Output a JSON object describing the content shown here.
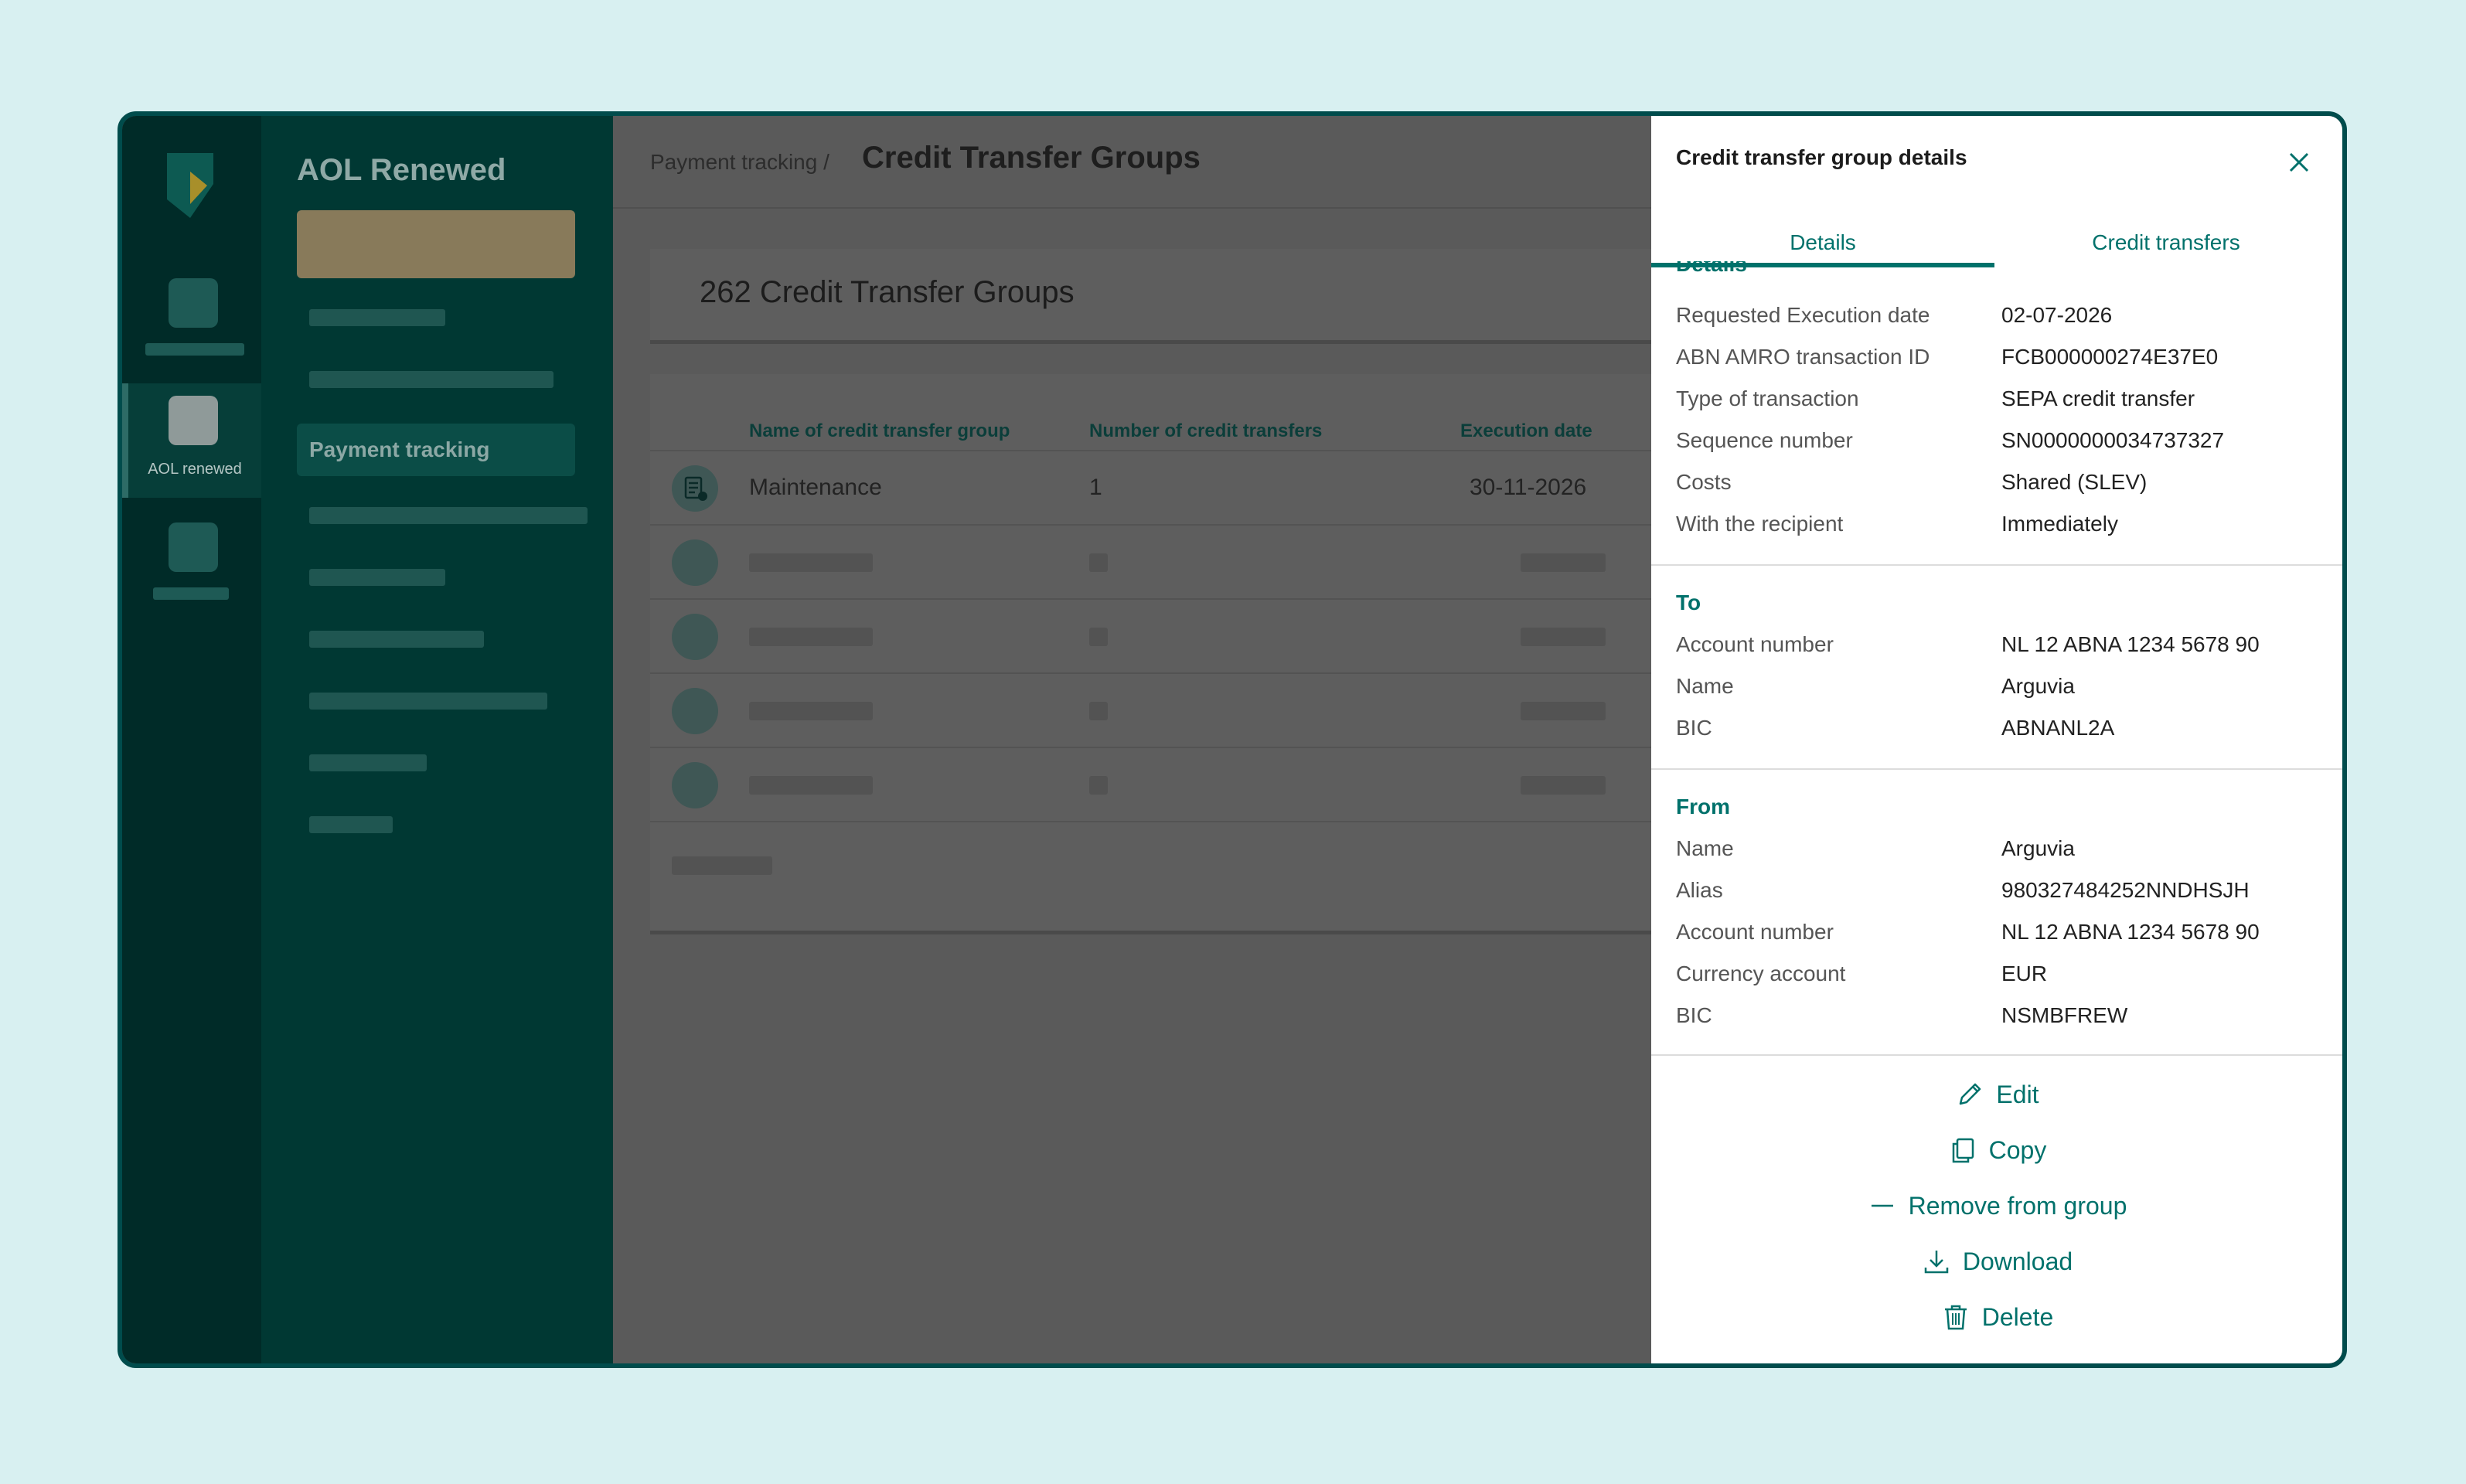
{
  "app": {
    "name": "AOL Renewed",
    "rail_active_label": "AOL renewed",
    "sidebar_active_item": "Payment tracking"
  },
  "header": {
    "breadcrumb": "Payment tracking /",
    "title": "Credit Transfer Groups"
  },
  "summary": {
    "count_title": "262 Credit Transfer Groups"
  },
  "table": {
    "columns": [
      "Name of credit transfer group",
      "Number of credit transfers",
      "Execution date"
    ],
    "rows": [
      {
        "name": "Maintenance",
        "count": "1",
        "date": "30-11-2026"
      }
    ]
  },
  "drawer": {
    "title": "Credit transfer group details",
    "tabs": [
      "Details",
      "Credit transfers"
    ],
    "details_heading": "Details",
    "details": [
      {
        "label": "Requested Execution date",
        "value": "02-07-2026"
      },
      {
        "label": "ABN AMRO transaction ID",
        "value": "FCB000000274E37E0"
      },
      {
        "label": "Type of transaction",
        "value": "SEPA credit transfer"
      },
      {
        "label": "Sequence number",
        "value": "SN0000000034737327"
      },
      {
        "label": "Costs",
        "value": "Shared (SLEV)"
      },
      {
        "label": "With the recipient",
        "value": "Immediately"
      }
    ],
    "to_heading": "To",
    "to": [
      {
        "label": "Account number",
        "value": "NL 12 ABNA 1234 5678 90"
      },
      {
        "label": "Name",
        "value": "Arguvia"
      },
      {
        "label": "BIC",
        "value": "ABNANL2A"
      }
    ],
    "from_heading": "From",
    "from": [
      {
        "label": "Name",
        "value": "Arguvia"
      },
      {
        "label": "Alias",
        "value": "980327484252NNDHSJH"
      },
      {
        "label": "Account number",
        "value": "NL 12 ABNA 1234 5678 90"
      },
      {
        "label": "Currency account",
        "value": "EUR"
      },
      {
        "label": "BIC",
        "value": "NSMBFREW"
      }
    ],
    "actions": {
      "edit": "Edit",
      "copy": "Copy",
      "remove": "Remove from group",
      "download": "Download",
      "delete": "Delete"
    }
  },
  "colors": {
    "accent": "#00716b",
    "frame": "#004c4c",
    "background": "#d8f0f1"
  }
}
